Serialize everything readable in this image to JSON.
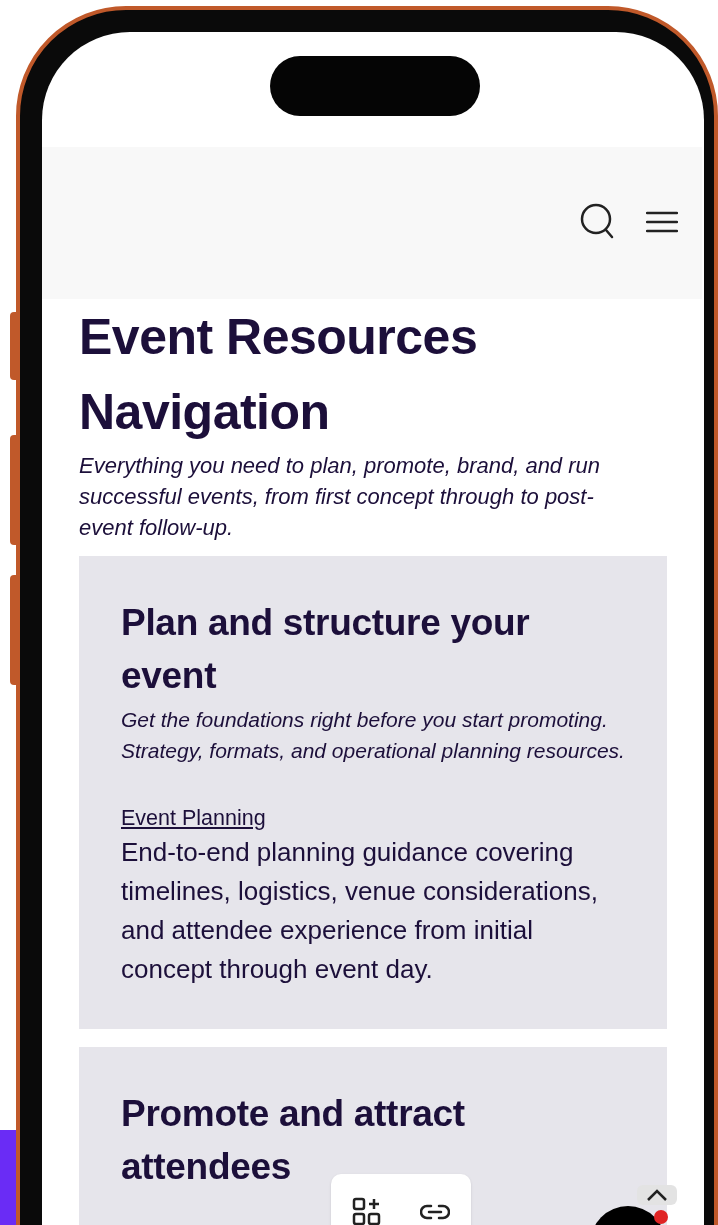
{
  "page": {
    "title": "Event Resources Navigation",
    "intro": "Everything you need to plan, promote, brand, and run successful events, from first concept through to post-event follow-up."
  },
  "sections": [
    {
      "heading": "Plan and structure your event",
      "description": "Get the foundations right before you start promoting. Strategy, formats, and operational planning resources.",
      "links": [
        {
          "label": "Event Planning",
          "description": "End-to-end planning guidance covering timelines, logistics, venue considerations, and attendee experience from initial concept through event day."
        }
      ]
    },
    {
      "heading": "Promote and attract attendees"
    }
  ]
}
